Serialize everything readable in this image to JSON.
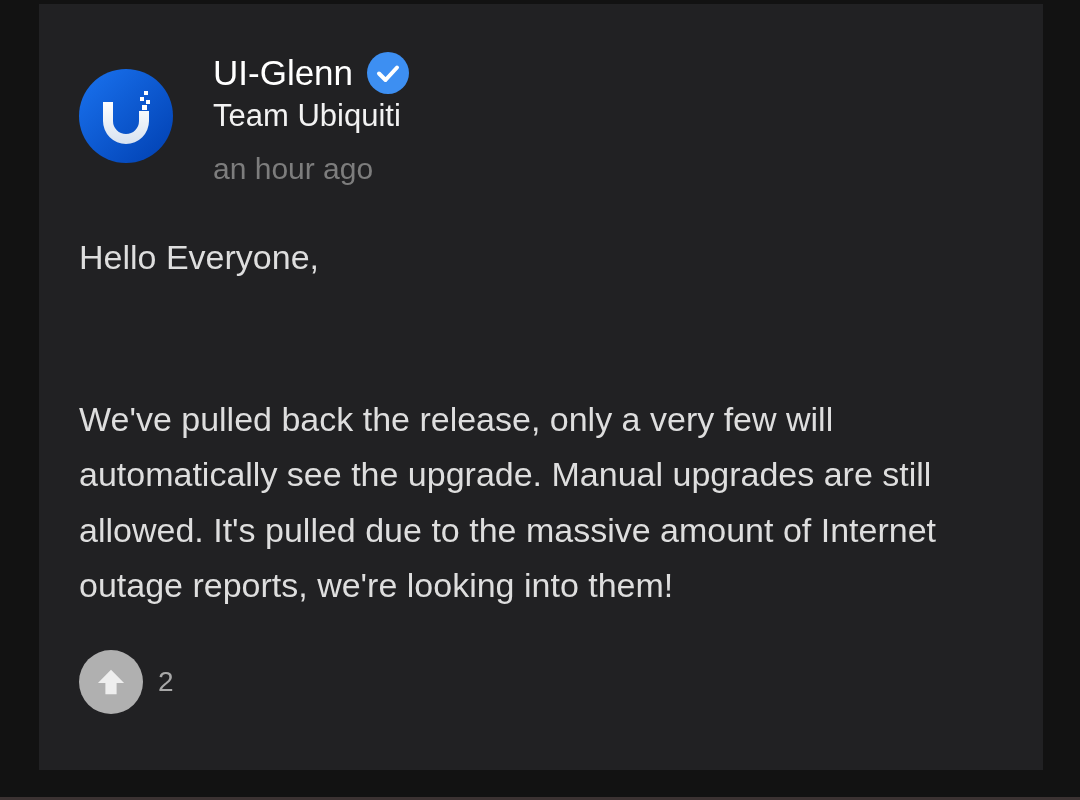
{
  "post": {
    "author": {
      "name": "UI-Glenn",
      "verified": true,
      "team": "Team Ubiquiti"
    },
    "time": "an hour ago",
    "body": [
      "Hello Everyone,",
      "We've pulled back the release, only a very few will automatically see the upgrade. Manual upgrades are still allowed. It's pulled due to the massive amount of Internet outage reports, we're looking into them!"
    ],
    "upvotes": {
      "count": "2"
    }
  }
}
